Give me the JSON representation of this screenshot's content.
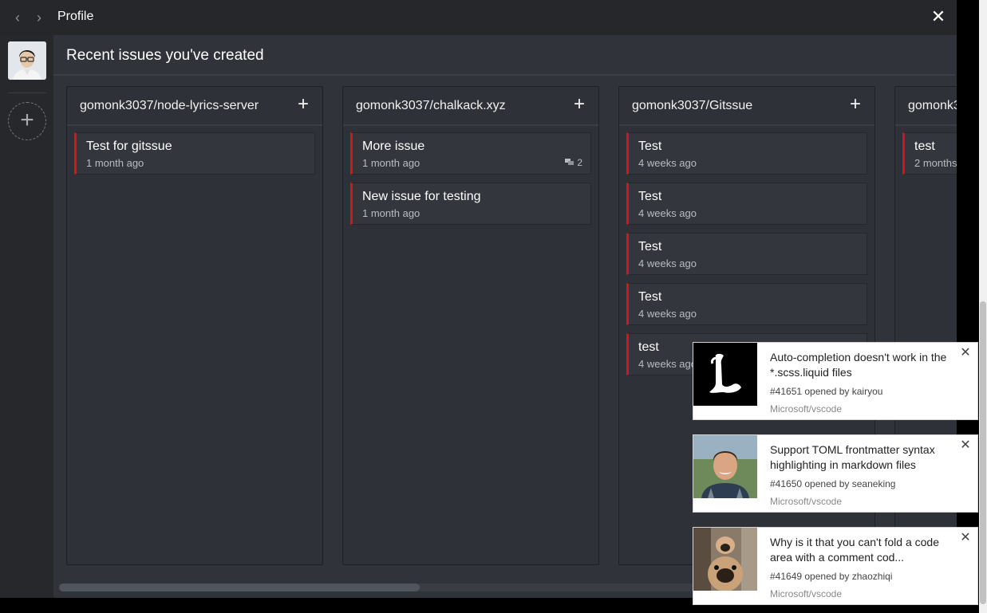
{
  "window": {
    "title": "Profile",
    "back_icon": "‹",
    "forward_icon": "›",
    "close_icon": "✕"
  },
  "sidebar": {
    "add_account_icon": "+"
  },
  "main": {
    "heading": "Recent issues you've created",
    "accent_color": "#d2161d"
  },
  "columns": [
    {
      "repo": "gomonk3037/node-lyrics-server",
      "add_icon": "+",
      "issues": [
        {
          "title": "Test for gitssue",
          "time": "1 month ago"
        }
      ]
    },
    {
      "repo": "gomonk3037/chalkack.xyz",
      "add_icon": "+",
      "issues": [
        {
          "title": "More issue",
          "time": "1 month ago",
          "comments": "2"
        },
        {
          "title": "New issue for testing",
          "time": "1 month ago"
        }
      ]
    },
    {
      "repo": "gomonk3037/Gitssue",
      "add_icon": "+",
      "issues": [
        {
          "title": "Test",
          "time": "4 weeks ago"
        },
        {
          "title": "Test",
          "time": "4 weeks ago"
        },
        {
          "title": "Test",
          "time": "4 weeks ago"
        },
        {
          "title": "Test",
          "time": "4 weeks ago"
        },
        {
          "title": "test",
          "time": "4 weeks ago"
        }
      ]
    },
    {
      "repo": "gomonk3",
      "add_icon": "+",
      "issues": [
        {
          "title": "test",
          "time": "2 months"
        }
      ]
    }
  ],
  "notifications": [
    {
      "title": "Auto-completion doesn't work in the *.scss.liquid files",
      "meta": "#41651 opened by kairyou",
      "repo": "Microsoft/vscode",
      "close_icon": "✕"
    },
    {
      "title": "Support TOML frontmatter syntax highlighting in markdown files",
      "meta": "#41650 opened by seaneking",
      "repo": "Microsoft/vscode",
      "close_icon": "✕"
    },
    {
      "title": "Why is it that you can't fold a code area with a comment cod...",
      "meta": "#41649 opened by zhaozhiqi",
      "repo": "Microsoft/vscode",
      "close_icon": "✕"
    }
  ]
}
